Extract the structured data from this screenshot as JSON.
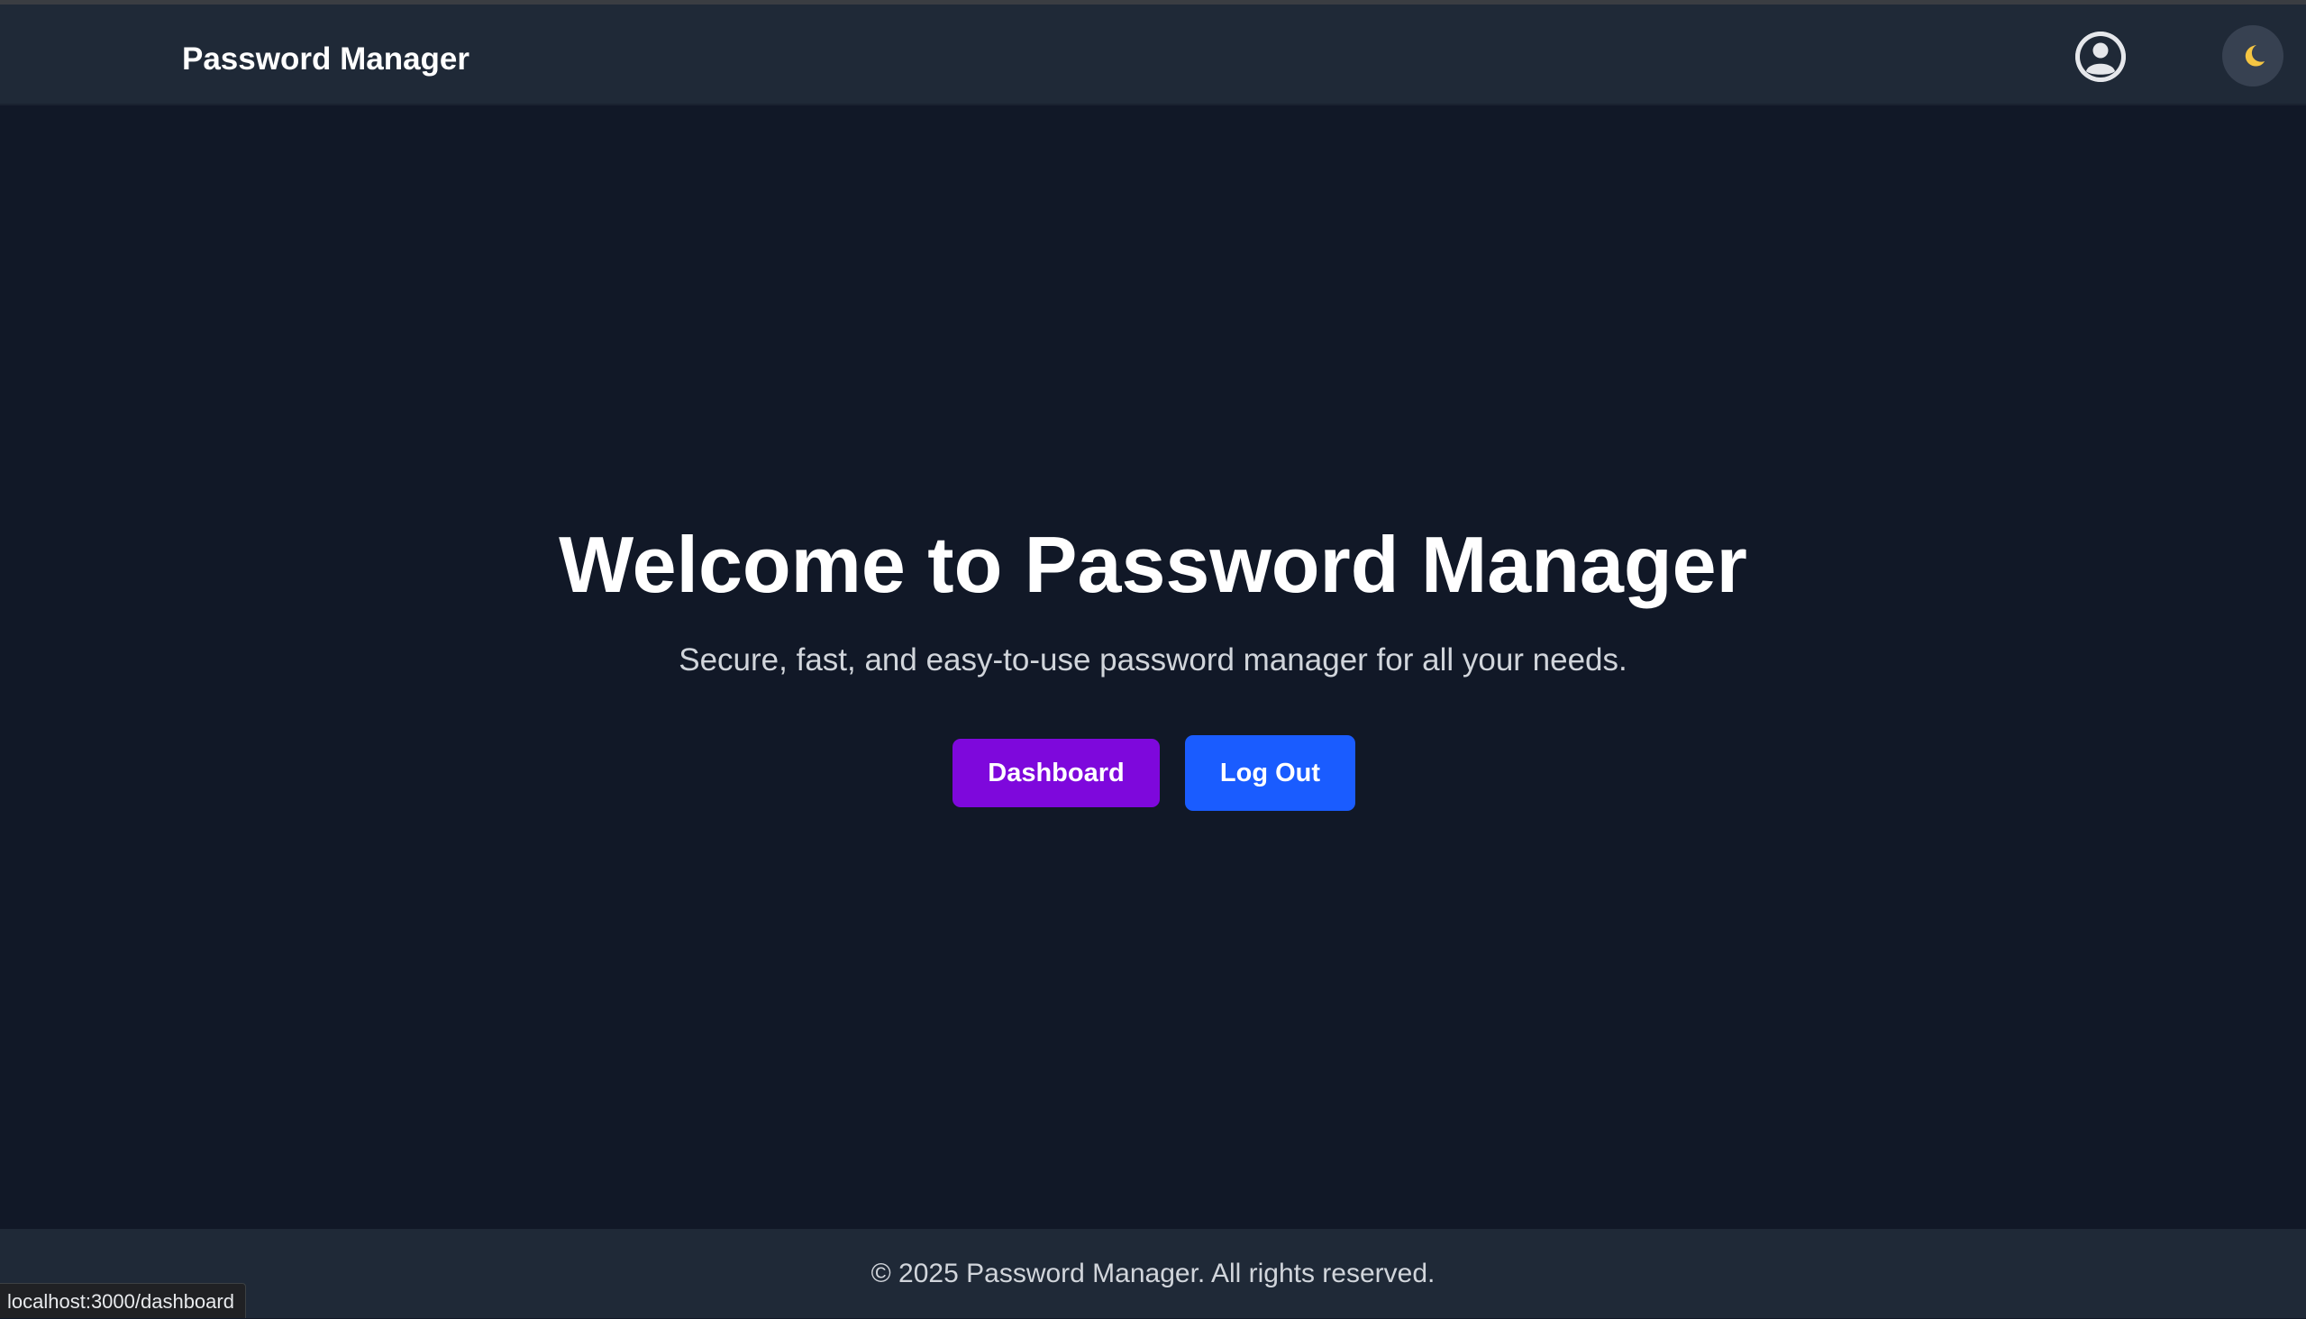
{
  "navbar": {
    "brand": "Password Manager",
    "avatar_icon": "user-avatar-icon",
    "theme_toggle_icon": "moon-icon"
  },
  "hero": {
    "title": "Welcome to Password Manager",
    "subtitle": "Secure, fast, and easy-to-use password manager for all your needs.",
    "dashboard_label": "Dashboard",
    "logout_label": "Log Out"
  },
  "footer": {
    "text": "© 2025 Password Manager. All rights reserved."
  },
  "status_bar": {
    "url": "localhost:3000/dashboard"
  },
  "colors": {
    "background": "#111827",
    "navbar": "#1f2937",
    "dashboard_button": "#7e08dc",
    "logout_button": "#1a5cff",
    "moon": "#f5c542"
  }
}
